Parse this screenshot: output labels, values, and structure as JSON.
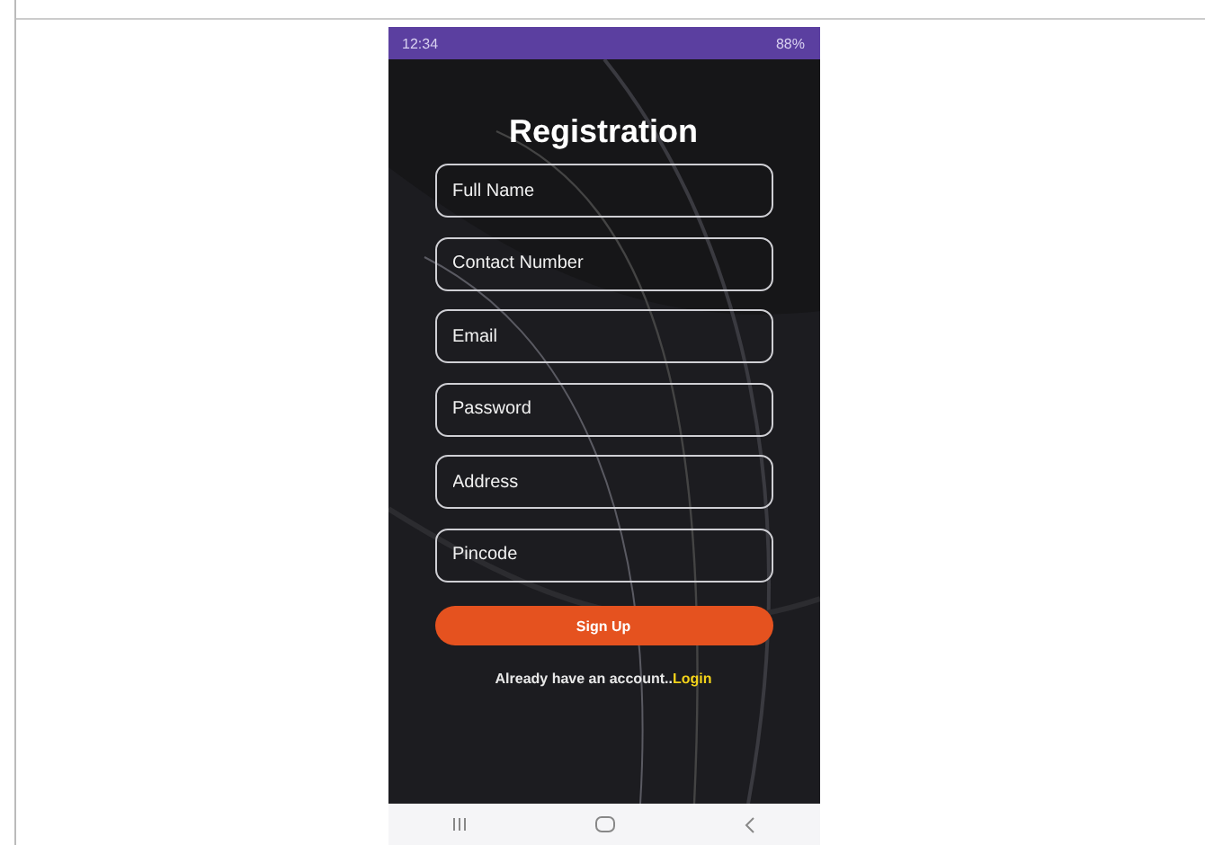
{
  "status_bar": {
    "time": "12:34",
    "battery": "88%"
  },
  "title": "Registration",
  "fields": [
    {
      "placeholder": "Full Name"
    },
    {
      "placeholder": "Contact Number"
    },
    {
      "placeholder": "Email"
    },
    {
      "placeholder": "Password"
    },
    {
      "placeholder": "Address"
    },
    {
      "placeholder": "Pincode"
    }
  ],
  "submit": "Sign Up",
  "footer": {
    "text": "Already have an account..",
    "link": "Login"
  }
}
